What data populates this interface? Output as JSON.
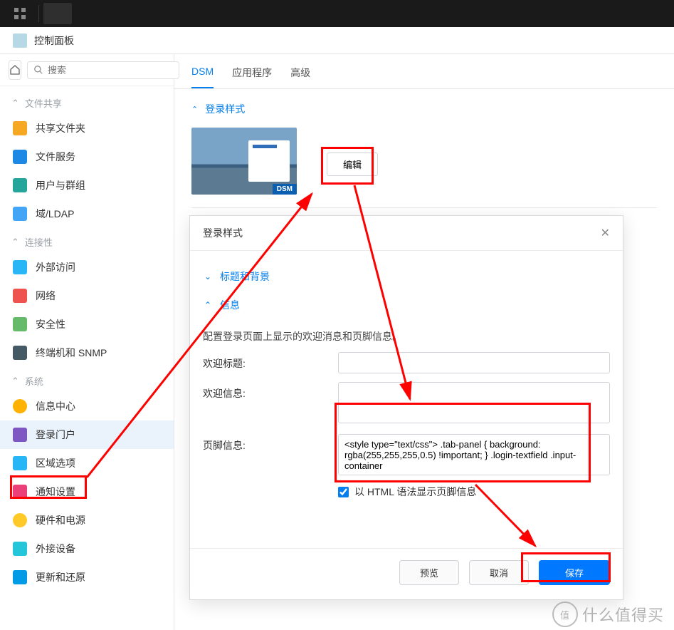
{
  "window_title": "控制面板",
  "search_placeholder": "搜索",
  "nav": {
    "group_fileshare": "文件共享",
    "item_sharedfolder": "共享文件夹",
    "item_fileservice": "文件服务",
    "item_usergroup": "用户与群组",
    "item_ldap": "域/LDAP",
    "group_connect": "连接性",
    "item_extaccess": "外部访问",
    "item_network": "网络",
    "item_security": "安全性",
    "item_terminal": "终端机和 SNMP",
    "group_system": "系统",
    "item_infocenter": "信息中心",
    "item_loginportal": "登录门户",
    "item_regional": "区域选项",
    "item_notify": "通知设置",
    "item_hardware": "硬件和电源",
    "item_external": "外接设备",
    "item_update": "更新和还原"
  },
  "tabs": {
    "dsm": "DSM",
    "apps": "应用程序",
    "adv": "高级"
  },
  "section": {
    "login_style": "登录样式",
    "edit_btn": "编辑",
    "dsm_badge": "DSM"
  },
  "modal": {
    "title": "登录样式",
    "acc_title_bg": "标题和背景",
    "acc_info": "信息",
    "desc": "配置登录页面上显示的欢迎消息和页脚信息。",
    "lbl_welcome_title": "欢迎标题:",
    "lbl_welcome_msg": "欢迎信息:",
    "lbl_footer": "页脚信息:",
    "footer_value": "<style type=\"text/css\"> .tab-panel { background: rgba(255,255,255,0.5) !important; } .login-textfield .input-container",
    "chk_html": "以 HTML 语法显示页脚信息",
    "btn_preview": "预览",
    "btn_cancel": "取消",
    "btn_save": "保存"
  },
  "watermark": "什么值得买"
}
